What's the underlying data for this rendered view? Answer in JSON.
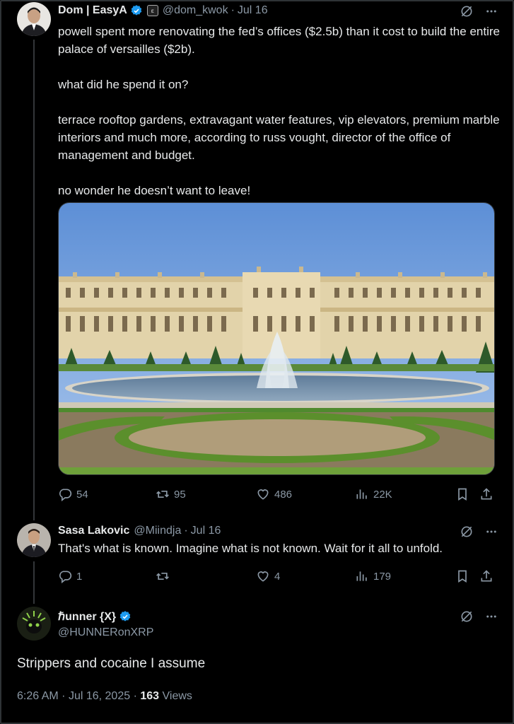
{
  "tweet1": {
    "name": "Dom | EasyA",
    "handle": "@dom_kwok",
    "dot": "·",
    "date": "Jul 16",
    "paragraphs": [
      "powell spent more renovating the fed’s offices ($2.5b) than it cost to build the entire palace of versailles ($2b).",
      "what did he spend it on?",
      "terrace rooftop gardens, extravagant water features, vip elevators, premium marble interiors and much more, according to russ vought, director of the office of management and budget.",
      "no wonder he doesn’t want to leave!"
    ],
    "stats": {
      "replies": "54",
      "reposts": "95",
      "likes": "486",
      "views": "22K"
    }
  },
  "tweet2": {
    "name": "Sasa Lakovic",
    "handle": "@Miindja",
    "dot": "·",
    "date": "Jul 16",
    "text": "That's what is known. Imagine what is not known. Wait for it all to unfold.",
    "stats": {
      "replies": "1",
      "reposts": "",
      "likes": "4",
      "views": "179"
    }
  },
  "tweet3": {
    "name": "ℏunner {X}",
    "handle": "@HUNNERonXRP",
    "text": "Strippers and cocaine I assume",
    "time": "6:26 AM",
    "dot": "·",
    "date": "Jul 16, 2025",
    "dot2": "·",
    "views_count": "163",
    "views_label": "Views"
  },
  "icons": [
    "grok-icon",
    "more-icon",
    "reply-icon",
    "repost-icon",
    "like-icon",
    "views-icon",
    "bookmark-icon",
    "share-icon",
    "verified-icon"
  ],
  "colors": {
    "background": "#000000",
    "text": "#e7e9ea",
    "muted": "#8b98a5",
    "verified": "#1d9bf0"
  }
}
